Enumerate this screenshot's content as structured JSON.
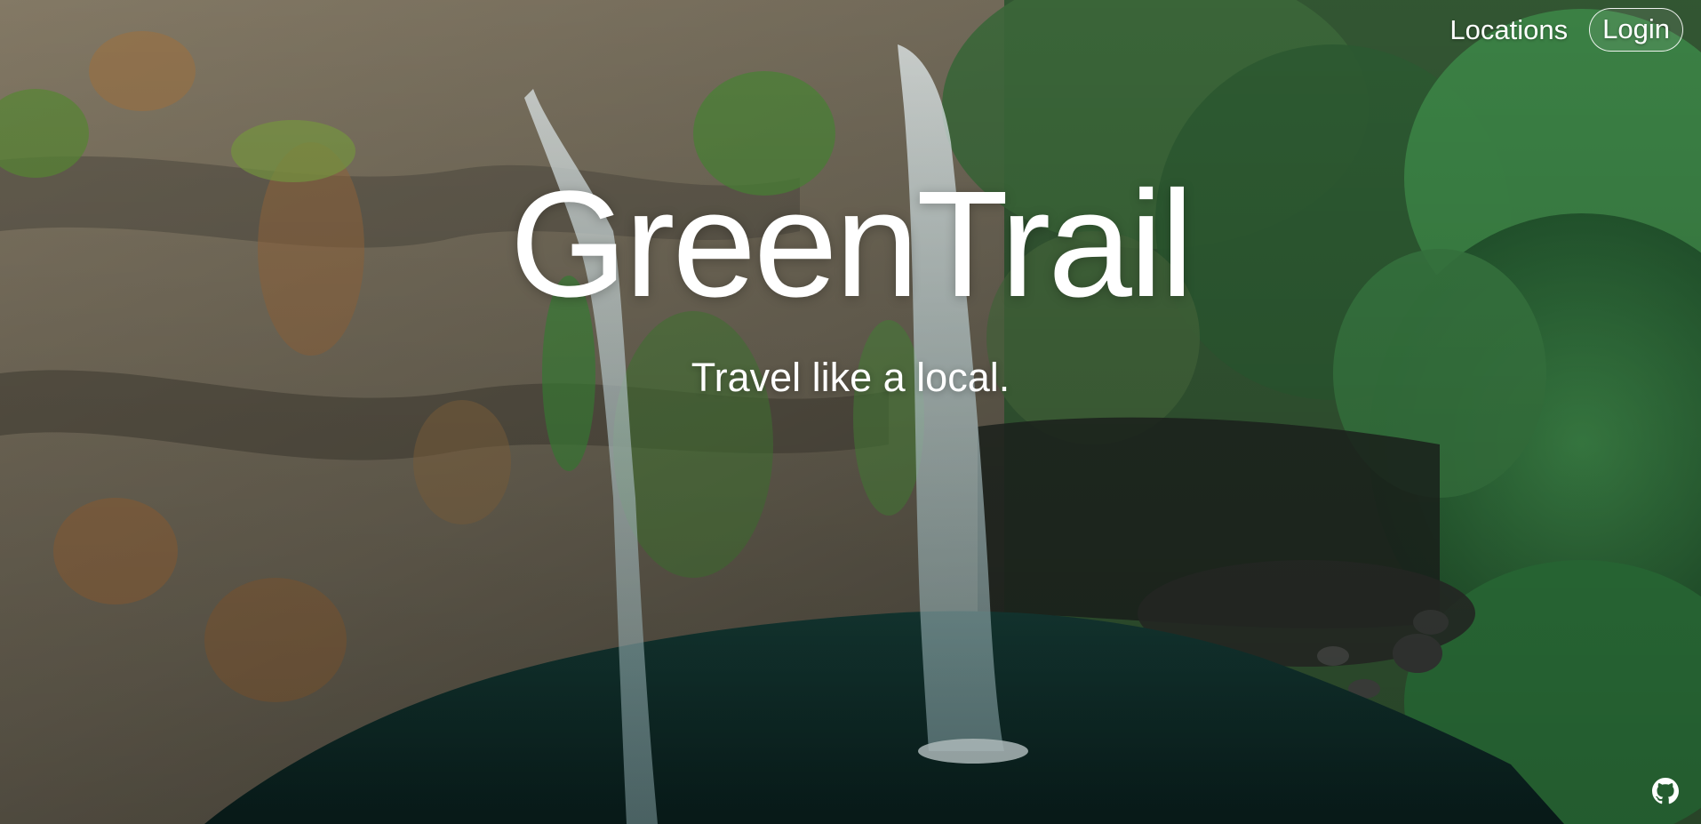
{
  "nav": {
    "locations_label": "Locations",
    "login_label": "Login"
  },
  "hero": {
    "title": "GreenTrail",
    "subtitle": "Travel like a local."
  },
  "footer": {
    "github_icon": "github-icon"
  },
  "colors": {
    "text": "#ffffff",
    "cliff": "#6b6456",
    "foliage": "#2f6b3a",
    "water": "#0f2f2c"
  }
}
